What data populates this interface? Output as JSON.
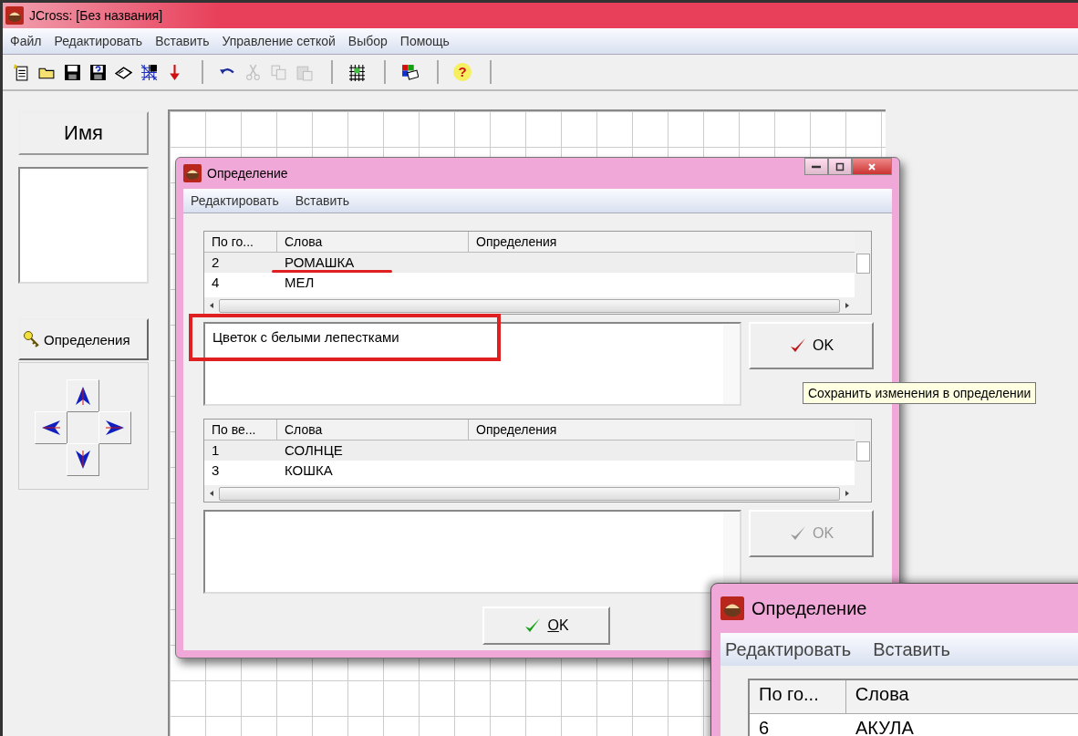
{
  "window": {
    "title": "JCross: [Без названия]"
  },
  "menu": [
    "Файл",
    "Редактировать",
    "Вставить",
    "Управление сеткой",
    "Выбор",
    "Помощь"
  ],
  "toolbar": [
    {
      "buttons": [
        {
          "kind": "new",
          "disabled": false
        },
        {
          "kind": "open",
          "disabled": false
        },
        {
          "kind": "save",
          "disabled": false
        },
        {
          "kind": "save-as",
          "disabled": false
        },
        {
          "kind": "book",
          "disabled": false
        },
        {
          "kind": "numbered-grid",
          "disabled": false
        },
        {
          "kind": "down-arrow",
          "disabled": false
        }
      ]
    },
    {
      "buttons": [
        {
          "kind": "undo",
          "disabled": false
        },
        {
          "kind": "cut",
          "disabled": true
        },
        {
          "kind": "copy",
          "disabled": true
        },
        {
          "kind": "paste",
          "disabled": true
        }
      ]
    },
    {
      "buttons": [
        {
          "kind": "grid",
          "disabled": false
        }
      ]
    },
    {
      "buttons": [
        {
          "kind": "palette",
          "disabled": false
        }
      ]
    },
    {
      "buttons": [
        {
          "kind": "help",
          "disabled": false,
          "label": "?"
        }
      ]
    }
  ],
  "left_panel": {
    "name_button": "Имя",
    "definitions_button": "Определения"
  },
  "dialog": {
    "title": "Определение",
    "menu": [
      "Редактировать",
      "Вставить"
    ],
    "across": {
      "columns": [
        "По го...",
        "Слова",
        "Определения"
      ],
      "rows": [
        {
          "number": "2",
          "word": "РОМАШКА",
          "selected": true
        },
        {
          "number": "4",
          "word": "МЕЛ",
          "selected": false
        }
      ],
      "definition": "Цветок с белыми лепестками",
      "ok_button": {
        "label": "OK",
        "disabled": false
      }
    },
    "down": {
      "columns": [
        "По ве...",
        "Слова",
        "Определения"
      ],
      "rows": [
        {
          "number": "1",
          "word": "СОЛНЦЕ",
          "selected": true
        },
        {
          "number": "3",
          "word": "КОШКА",
          "selected": false
        }
      ],
      "ok_button": {
        "label": "OK",
        "disabled": true
      }
    },
    "ok_button": "OK",
    "tooltip": "Сохранить изменения в определении",
    "annotations": [
      {
        "kind": "underline"
      },
      {
        "kind": "rectangle"
      }
    ]
  },
  "second_dialog": {
    "title": "Определение",
    "menu": [
      "Редактировать",
      "Вставить"
    ],
    "columns": [
      "По го...",
      "Слова"
    ],
    "rows": [
      {
        "number": "6",
        "word": "АКУЛА"
      }
    ]
  }
}
